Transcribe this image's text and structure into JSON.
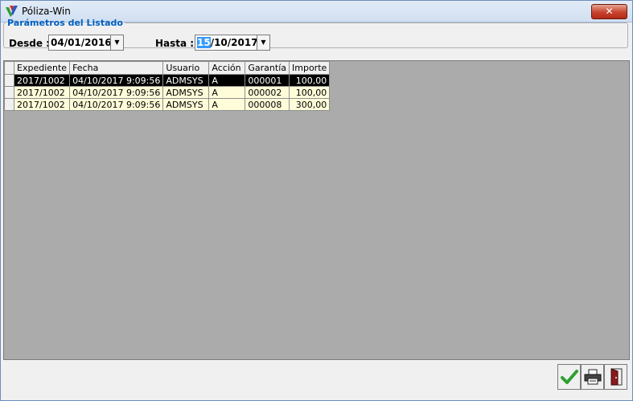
{
  "window": {
    "title": "Póliza-Win",
    "close_label": "✕"
  },
  "params": {
    "legend": "Parámetros del Listado",
    "desde_label": "Desde :",
    "desde_value": "04/01/2016",
    "hasta_label": "Hasta :",
    "hasta_selected": "15",
    "hasta_rest": "/10/2017"
  },
  "grid": {
    "columns": [
      "Expediente",
      "Fecha",
      "Usuario",
      "Acción",
      "Garantía",
      "Importe"
    ],
    "rows": [
      [
        "2017/1002",
        "04/10/2017 9:09:56",
        "ADMSYS",
        "A",
        "000001",
        "100,00"
      ],
      [
        "2017/1002",
        "04/10/2017 9:09:56",
        "ADMSYS",
        "A",
        "000002",
        "100,00"
      ],
      [
        "2017/1002",
        "04/10/2017 9:09:56",
        "ADMSYS",
        "A",
        "000008",
        "300,00"
      ]
    ]
  },
  "buttons": {
    "accept_icon": "checkmark-icon",
    "print_icon": "printer-icon",
    "exit_icon": "exit-door-icon"
  },
  "colors": {
    "selected_row": "#000000",
    "row_bg": "#fffcd9",
    "grid_bg": "#ababab",
    "legend": "#0060c0"
  }
}
